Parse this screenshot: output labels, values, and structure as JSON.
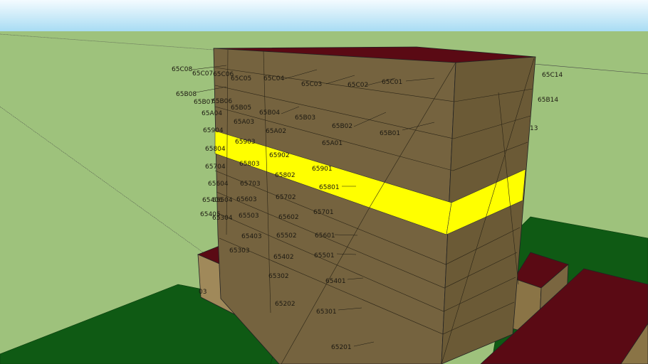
{
  "colors": {
    "sky_top": "#f4fbff",
    "sky_bottom": "#a8dcf3",
    "ground_far": "#9ec27c",
    "ground_near": "#0f5a14",
    "wall_front": "#75633f",
    "wall_side": "#6b5a36",
    "roof": "#5a0a14",
    "highlight": "#ffff00",
    "small_box": "#a0895a"
  },
  "labels": {
    "65C08": "65C08",
    "65C07": "65C07",
    "65C06": "65C06",
    "65C05": "65C05",
    "65C04": "65C04",
    "65C03": "65C03",
    "65C02": "65C02",
    "65C01": "65C01",
    "65C14": "65C14",
    "65B08": "65B08",
    "65B07": "65B07",
    "65B06": "65B06",
    "65B05": "65B05",
    "65B04": "65B04",
    "65B03": "65B03",
    "65B02": "65B02",
    "65B01": "65B01",
    "65B14": "65B14",
    "65A04": "65A04",
    "65A03": "65A03",
    "65A02": "65A02",
    "65A01": "65A01",
    "t13": "13",
    "65904": "65904",
    "65903": "65903",
    "65902": "65902",
    "65901": "65901",
    "65804": "65804",
    "65803": "65803",
    "65802": "65802",
    "65801": "65801",
    "65704": "65704",
    "65703": "65703",
    "65702": "65702",
    "65701": "65701",
    "65604": "65604",
    "65603": "65603",
    "65602": "65602",
    "65601": "65601",
    "65406": "65406",
    "65504": "65504",
    "65503": "65503",
    "65502": "65502",
    "65501": "65501",
    "65405": "65405",
    "65304": "65304",
    "65403": "65403",
    "65402": "65402",
    "65401": "65401",
    "65303": "65303",
    "65302": "65302",
    "65301": "65301",
    "65202": "65202",
    "65201": "65201",
    "t03": "03"
  }
}
